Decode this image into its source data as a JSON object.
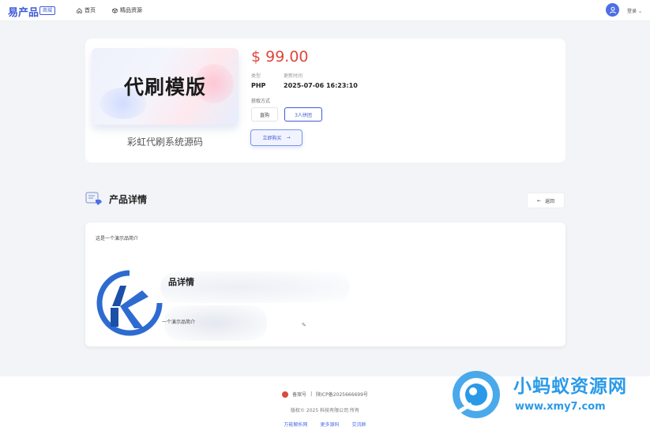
{
  "header": {
    "logo": "易产品",
    "logo_badge": "商城",
    "nav": [
      {
        "label": "首页",
        "icon": "home-icon"
      },
      {
        "label": "精品资源",
        "icon": "cube-icon"
      }
    ],
    "user_label": "登录"
  },
  "product": {
    "cover_text": "代刷模版",
    "name": "彩虹代刷系统源码",
    "price": "$ 99.00",
    "type_label": "类型",
    "type_value": "PHP",
    "time_label": "更新时间",
    "time_value": "2025-07-06 16:23:10",
    "obtain_label": "获取方式",
    "options": [
      "直购",
      "3人拼团"
    ],
    "buy_label": "立即购买"
  },
  "details": {
    "title": "产品详情",
    "back_label": "返回",
    "intro": "这是一个演示品简介",
    "embed_title": "品详情",
    "embed_intro": "一个演示品简介"
  },
  "footer": {
    "icp_label": "备案号",
    "icp_value": "陕ICP备2025666699号",
    "copyright": "版权© 2025 科技有限公司 所有",
    "links": [
      "万能解析网",
      "更多源码",
      "交流群"
    ]
  },
  "watermark": {
    "text": "小蚂蚁资源网",
    "url": "www.xmy7.com"
  },
  "colors": {
    "accent": "#3f5bd7",
    "price": "#e0463c",
    "watermark": "#2a9ae8"
  }
}
